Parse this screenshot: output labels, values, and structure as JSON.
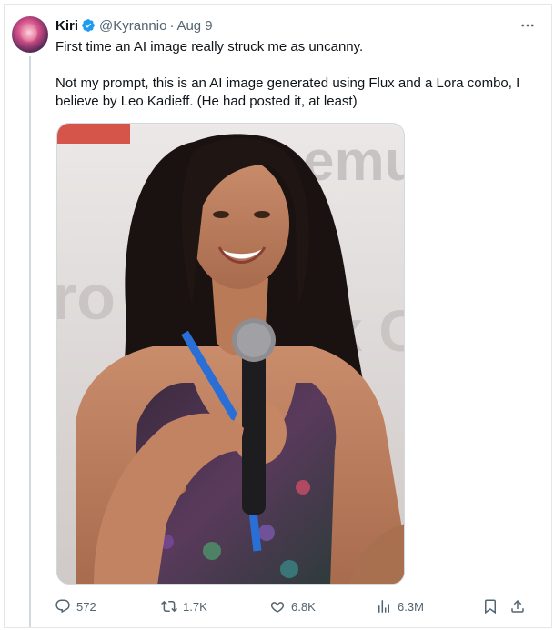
{
  "tweet": {
    "author_name": "Kiri",
    "handle": "@Kyrannio",
    "date": "Aug 9",
    "separator": "·",
    "text": "First time an AI image really struck me as uncanny.\n\nNot my prompt, this is an AI image generated using Flux and a Lora combo, I believe by Leo Kadieff. (He had posted it, at least)",
    "more_icon": "more-horizontal-icon",
    "verified_icon": "verified-badge-icon",
    "media": {
      "description_icon": "photo",
      "background_text": "remu"
    },
    "actions": {
      "replies": "572",
      "reposts": "1.7K",
      "likes": "6.8K",
      "views": "6.3M"
    }
  },
  "colors": {
    "accent": "#1d9bf0",
    "muted": "#536471",
    "text": "#0f1419",
    "border": "#cfd9de"
  }
}
